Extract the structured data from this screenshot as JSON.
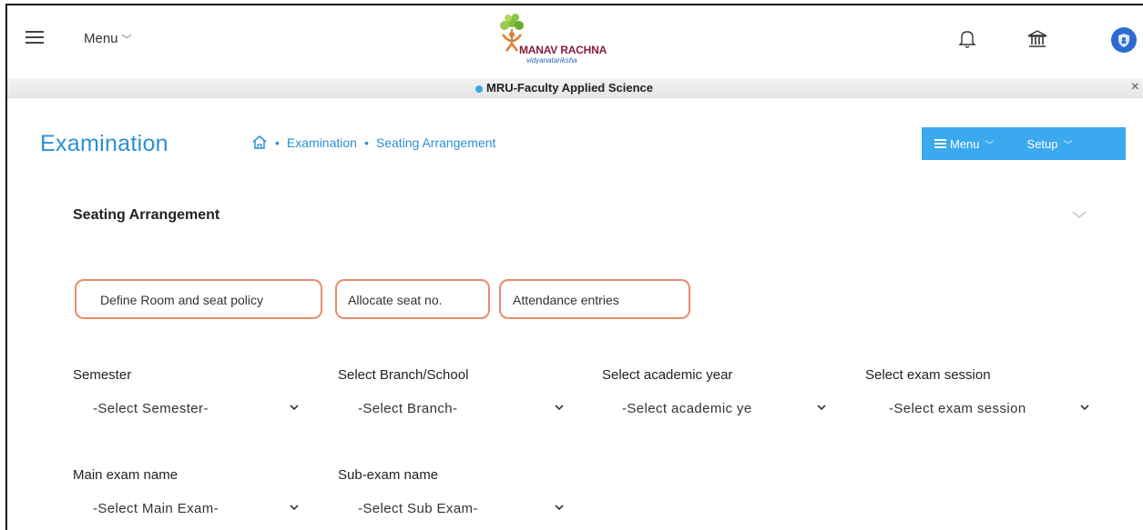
{
  "header": {
    "menu_label": "Menu",
    "logo_text": "MANAV RACHNA",
    "logo_subtext": "vidyanatariksha"
  },
  "org_bar": {
    "label": "MRU-Faculty Applied Science",
    "close_symbol": "×"
  },
  "page": {
    "title": "Examination",
    "breadcrumb": [
      "Examination",
      "Seating Arrangement"
    ],
    "breadcrumb_sep": "•"
  },
  "action_bar": {
    "menu_label": "Menu",
    "setup_label": "Setup",
    "color": "#3aa9ef"
  },
  "section": {
    "title": "Seating Arrangement",
    "tabs": [
      {
        "label": "Define Room and seat policy"
      },
      {
        "label": "Allocate seat no."
      },
      {
        "label": "Attendance entries"
      }
    ],
    "tab_highlight_color": "#e98b6b"
  },
  "form": {
    "fields": [
      {
        "label": "Semester",
        "value": "-Select Semester-"
      },
      {
        "label": "Select Branch/School",
        "value": "-Select Branch-"
      },
      {
        "label": "Select academic year",
        "value": "-Select academic ye"
      },
      {
        "label": "Select exam session",
        "value": "-Select exam session"
      },
      {
        "label": "Main exam name",
        "value": "-Select Main Exam-"
      },
      {
        "label": "Sub-exam name",
        "value": "-Select Sub Exam-"
      }
    ]
  },
  "icons": {
    "hamburger": "hamburger-icon",
    "bell": "bell-icon",
    "bank": "bank-icon",
    "avatar": "shield-avatar-icon",
    "home": "home-icon",
    "chevron": "chevron-down-icon"
  },
  "accent_color": "#2a8fd8"
}
